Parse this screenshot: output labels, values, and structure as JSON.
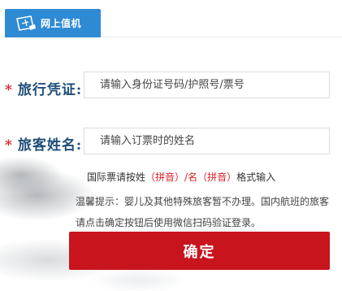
{
  "tab": {
    "label": "网上值机",
    "icon": "ticket-plane-icon"
  },
  "form": {
    "id_field": {
      "required_mark": "*",
      "label": "旅行凭证:",
      "placeholder": "请输入身份证号码/护照号/票号"
    },
    "name_field": {
      "required_mark": "*",
      "label": "旅客姓名:",
      "placeholder": "请输入订票时的姓名"
    },
    "intl_hint": {
      "prefix": "国际票请按姓",
      "pinyin1": "（拼音）",
      "slash": "/名",
      "pinyin2": "（拼音）",
      "suffix": "格式输入"
    },
    "notice": "温馨提示：婴儿及其他特殊旅客暂不办理。国内航班的旅客请点击确定按钮后使用微信扫码验证登录。",
    "submit_label": "确定"
  },
  "colors": {
    "tab_bg": "#2f8ad4",
    "label_text": "#1f4e79",
    "required_star": "#d9232d",
    "submit_bg": "#c8141c"
  }
}
